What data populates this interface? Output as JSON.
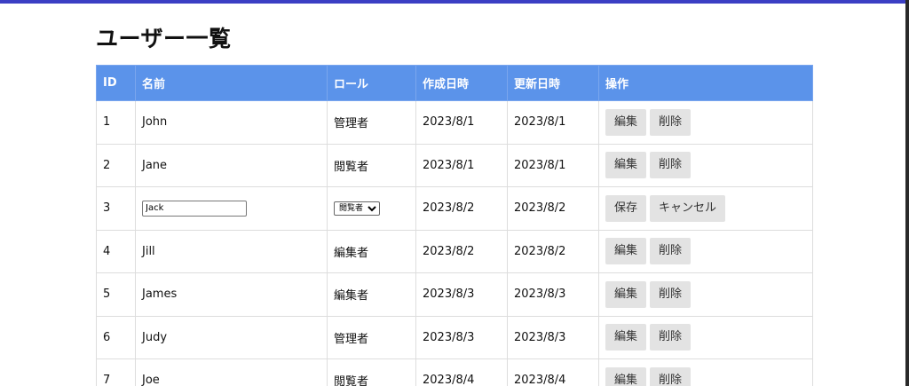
{
  "page": {
    "title": "ユーザー一覧"
  },
  "table": {
    "headers": [
      "ID",
      "名前",
      "ロール",
      "作成日時",
      "更新日時",
      "操作"
    ],
    "buttons": {
      "edit": "編集",
      "delete": "削除",
      "save": "保存",
      "cancel": "キャンセル"
    },
    "rows": [
      {
        "id": "1",
        "name": "John",
        "role": "管理者",
        "created": "2023/8/1",
        "updated": "2023/8/1"
      },
      {
        "id": "2",
        "name": "Jane",
        "role": "閲覧者",
        "created": "2023/8/1",
        "updated": "2023/8/1"
      },
      {
        "id": "3",
        "name": "Jack",
        "role": "閲覧者",
        "created": "2023/8/2",
        "updated": "2023/8/2",
        "editing": true
      },
      {
        "id": "4",
        "name": "Jill",
        "role": "編集者",
        "created": "2023/8/2",
        "updated": "2023/8/2"
      },
      {
        "id": "5",
        "name": "James",
        "role": "編集者",
        "created": "2023/8/3",
        "updated": "2023/8/3"
      },
      {
        "id": "6",
        "name": "Judy",
        "role": "管理者",
        "created": "2023/8/3",
        "updated": "2023/8/3"
      },
      {
        "id": "7",
        "name": "Joe",
        "role": "閲覧者",
        "created": "2023/8/4",
        "updated": "2023/8/4"
      }
    ]
  }
}
